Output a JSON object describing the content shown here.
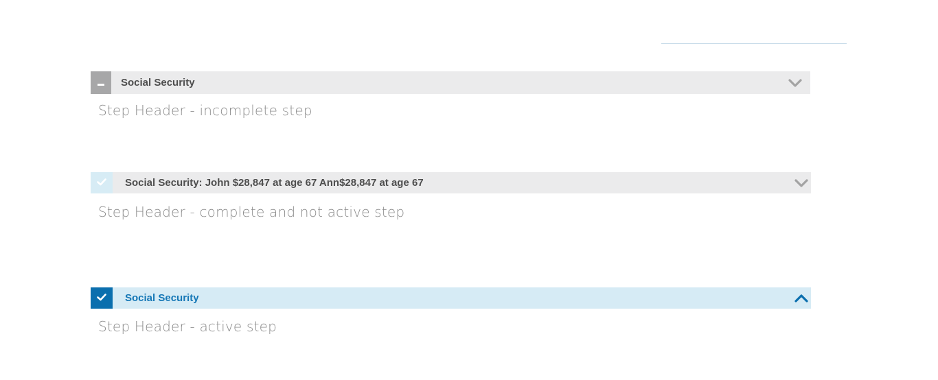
{
  "steps": [
    {
      "state": "incomplete",
      "header_title": "Social Security",
      "status_icon": "minus-icon",
      "toggle_icon": "chevron-down-icon",
      "caption": "Step Header - incomplete step"
    },
    {
      "state": "complete-not-active",
      "header_title": "Social Security: John $28,847 at age 67  Ann$28,847 at age 67",
      "status_icon": "check-icon",
      "toggle_icon": "chevron-down-icon",
      "caption": "Step Header - complete and not active step"
    },
    {
      "state": "active",
      "header_title": "Social Security",
      "status_icon": "check-icon",
      "toggle_icon": "chevron-up-icon",
      "caption": "Step Header - active step"
    }
  ],
  "colors": {
    "header_bg": "#ebebec",
    "active_header_bg": "#d6ebf5",
    "incomplete_status_bg": "#a7a7a8",
    "complete_status_bg": "#d7ecf5",
    "active_status_bg": "#0b6fae",
    "active_title": "#1577b6",
    "title_text": "#4e4e4e",
    "chevron_gray": "#a3a3a3",
    "caption_text": "#8c8c8c"
  }
}
